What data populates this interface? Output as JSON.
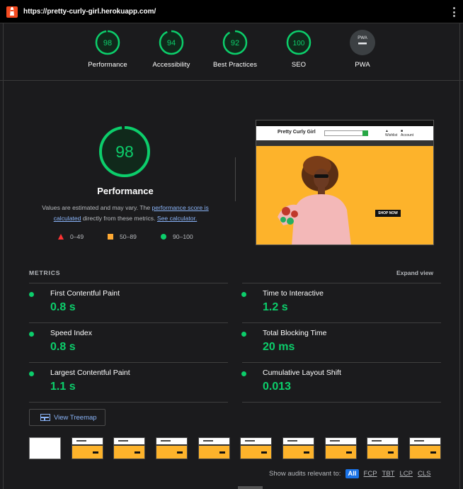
{
  "header": {
    "url": "https://pretty-curly-girl.herokuapp.com/",
    "logo_icon": "lighthouse-icon",
    "menu_icon": "more-vert-icon"
  },
  "categories": [
    {
      "label": "Performance",
      "score": "98",
      "value": 98,
      "color": "#0cce6b"
    },
    {
      "label": "Accessibility",
      "score": "94",
      "value": 94,
      "color": "#0cce6b"
    },
    {
      "label": "Best Practices",
      "score": "92",
      "value": 92,
      "color": "#0cce6b"
    },
    {
      "label": "SEO",
      "score": "100",
      "value": 100,
      "color": "#0cce6b"
    },
    {
      "label": "PWA",
      "score": "PWA",
      "color": "#9aa0a6"
    }
  ],
  "performance": {
    "score": "98",
    "score_value": 98,
    "title": "Performance",
    "desc_1": "Values are estimated and may vary. The ",
    "desc_link_1": "performance score is calculated",
    "desc_2": " directly from these metrics. ",
    "desc_link_2": "See calculator.",
    "legend": [
      {
        "range": "0–49",
        "shape": "triangle",
        "color": "#ff3333"
      },
      {
        "range": "50–89",
        "shape": "square",
        "color": "#ffaa33"
      },
      {
        "range": "90–100",
        "shape": "circle",
        "color": "#0cce6b"
      }
    ]
  },
  "screenshot": {
    "brand": "Pretty Curly Girl",
    "cta": "SHOP NOW",
    "icon_1": "Wishlist",
    "icon_2": "Account"
  },
  "metrics": {
    "heading": "METRICS",
    "expand_label": "Expand view",
    "items": [
      {
        "name": "First Contentful Paint",
        "value": "0.8 s"
      },
      {
        "name": "Time to Interactive",
        "value": "1.2 s"
      },
      {
        "name": "Speed Index",
        "value": "0.8 s"
      },
      {
        "name": "Total Blocking Time",
        "value": "20 ms"
      },
      {
        "name": "Largest Contentful Paint",
        "value": "1.1 s"
      },
      {
        "name": "Cumulative Layout Shift",
        "value": "0.013"
      }
    ]
  },
  "treemap": {
    "label": "View Treemap"
  },
  "audits_filter": {
    "label": "Show audits relevant to:",
    "chips": [
      "All",
      "FCP",
      "TBT",
      "LCP",
      "CLS"
    ],
    "active": "All"
  },
  "colors": {
    "good": "#0cce6b",
    "link": "#8ab4f8",
    "background": "#1b1b1d"
  }
}
